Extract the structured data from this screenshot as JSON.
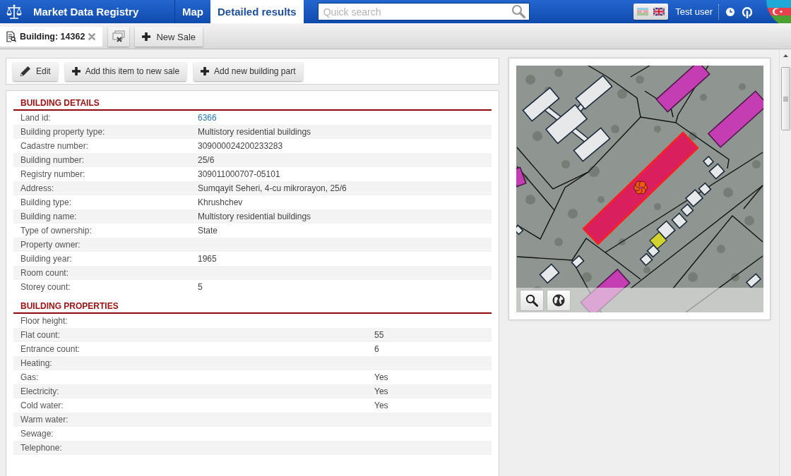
{
  "header": {
    "app_title": "Market Data Registry",
    "nav_tabs": [
      {
        "label": "Map",
        "selected": false
      },
      {
        "label": "Detailed results",
        "selected": true
      }
    ],
    "search": {
      "placeholder": "Quick search"
    },
    "languages": [
      {
        "kind": "az",
        "selected": false
      },
      {
        "kind": "en",
        "selected": true
      }
    ],
    "user": "Test user"
  },
  "tab_bar": {
    "tabs": [
      {
        "label": "Building: 14362",
        "selected": true
      }
    ],
    "buttons": [
      {
        "kind": "close_all"
      },
      {
        "kind": "add",
        "label": "New Sale"
      }
    ]
  },
  "actions": [
    {
      "kind": "edit",
      "label": "Edit"
    },
    {
      "kind": "add",
      "label": "Add this item to new sale"
    },
    {
      "kind": "add",
      "label": "Add new building part"
    }
  ],
  "sections": [
    {
      "title": "BUILDING DETAILS",
      "rows": [
        {
          "label": "Land id:",
          "value": "6366",
          "kind": "link"
        },
        {
          "label": "Building property type:",
          "value": "Multistory residential buildings",
          "kind": "text"
        },
        {
          "label": "Cadastre number:",
          "value": "309000024200233283",
          "kind": "text"
        },
        {
          "label": "Building number:",
          "value": "25/6",
          "kind": "text"
        },
        {
          "label": "Registry number:",
          "value": "309011000707-05101",
          "kind": "text"
        },
        {
          "label": "Address:",
          "value": "Sumqayit Seheri, 4-cu mikrorayon, 25/6",
          "kind": "text"
        },
        {
          "label": "Building type:",
          "value": "Khrushchev",
          "kind": "text"
        },
        {
          "label": "Building name:",
          "value": "Multistory residential buildings",
          "kind": "text"
        },
        {
          "label": "Type of ownership:",
          "value": "State",
          "kind": "text"
        },
        {
          "label": "Property owner:"
        },
        {
          "label": "Building year:",
          "value": "1965",
          "kind": "text"
        },
        {
          "label": "Room count:"
        },
        {
          "label": "Storey count:",
          "value": "5",
          "kind": "text"
        }
      ]
    },
    {
      "title": "BUILDING PROPERTIES",
      "rows": [
        {
          "label": "Floor height:"
        },
        {
          "label": "Flat count:",
          "value": "55",
          "kind": "text"
        },
        {
          "label": "Entrance count:",
          "value": "6",
          "kind": "text"
        },
        {
          "label": "Heating:"
        },
        {
          "label": "Gas:",
          "value": "Yes",
          "kind": "text"
        },
        {
          "label": "Electricity:",
          "value": "Yes",
          "kind": "text"
        },
        {
          "label": "Cold water:",
          "value": "Yes",
          "kind": "text"
        },
        {
          "label": "Warm water:"
        },
        {
          "label": "Sewage:"
        },
        {
          "label": "Telephone:"
        }
      ]
    }
  ]
}
